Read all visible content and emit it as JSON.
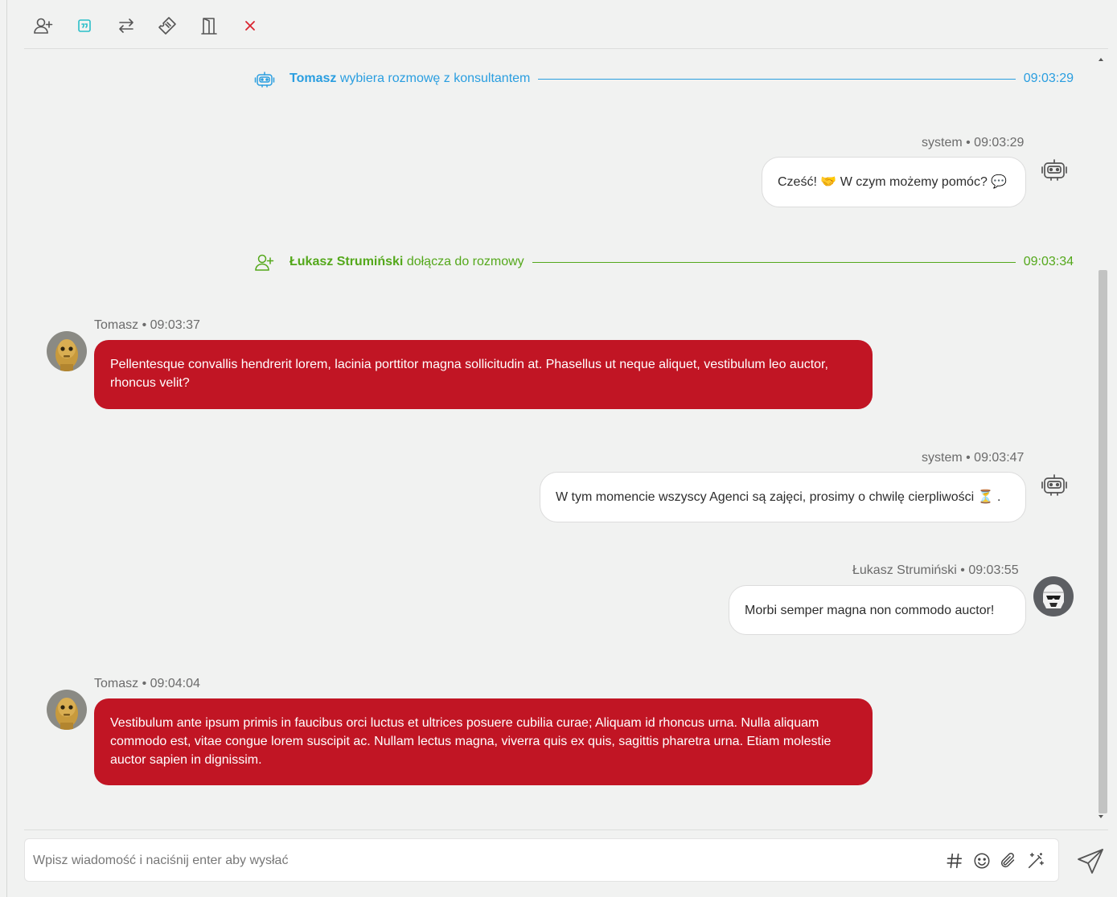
{
  "toolbar": {
    "buttons": [
      {
        "icon": "add-user-icon"
      },
      {
        "icon": "quote-icon"
      },
      {
        "icon": "transfer-icon"
      },
      {
        "icon": "ticket-icon"
      },
      {
        "icon": "door-exit-icon"
      },
      {
        "icon": "close-icon"
      }
    ]
  },
  "colors": {
    "accent_blue": "#2a9ee0",
    "accent_green": "#54a81b",
    "brand_red": "#c11524",
    "quote_teal": "#2bbfc9",
    "close_red": "#d9242f"
  },
  "events": [
    {
      "name": "Tomasz",
      "text": " wybiera rozmowę z konsultantem",
      "time": "09:03:29",
      "icon": "robot-icon",
      "color": "blue"
    },
    {
      "name": "Łukasz Strumiński",
      "text": " dołącza do rozmowy",
      "time": "09:03:34",
      "icon": "add-user-icon",
      "color": "green"
    }
  ],
  "messages": [
    {
      "meta": "system • 09:03:29",
      "text": "Cześć! 🤝 W czym możemy pomóc? 💬",
      "side": "right",
      "avatar": "robot-icon"
    },
    {
      "meta": "Tomasz • 09:03:37",
      "text": "Pellentesque convallis hendrerit lorem, lacinia porttitor magna sollicitudin at. Phasellus ut neque aliquet, vestibulum leo auctor, rhoncus velit?",
      "side": "left",
      "avatar": "avatar-gold-robot"
    },
    {
      "meta": "system • 09:03:47",
      "text": "W tym momencie wszyscy Agenci są zajęci, prosimy o chwilę cierpliwości ⏳ .",
      "side": "right",
      "avatar": "robot-icon"
    },
    {
      "meta": "Łukasz Strumiński • 09:03:55",
      "text": "Morbi semper magna non commodo auctor!",
      "side": "right",
      "avatar": "avatar-trooper"
    },
    {
      "meta": "Tomasz • 09:04:04",
      "text": "Vestibulum ante ipsum primis in faucibus orci luctus et ultrices posuere cubilia curae; Aliquam id rhoncus urna. Nulla aliquam commodo est, vitae congue lorem suscipit ac. Nullam lectus magna, viverra quis ex quis, sagittis pharetra urna. Etiam molestie auctor sapien in dignissim.",
      "side": "left",
      "avatar": "avatar-gold-robot"
    }
  ],
  "composer": {
    "placeholder": "Wpisz wiadomość i naciśnij enter aby wysłać",
    "value": "",
    "buttons": [
      {
        "icon": "hashtag-icon"
      },
      {
        "icon": "emoji-icon"
      },
      {
        "icon": "paperclip-icon"
      },
      {
        "icon": "magic-wand-icon"
      }
    ],
    "send_icon": "send-icon"
  }
}
